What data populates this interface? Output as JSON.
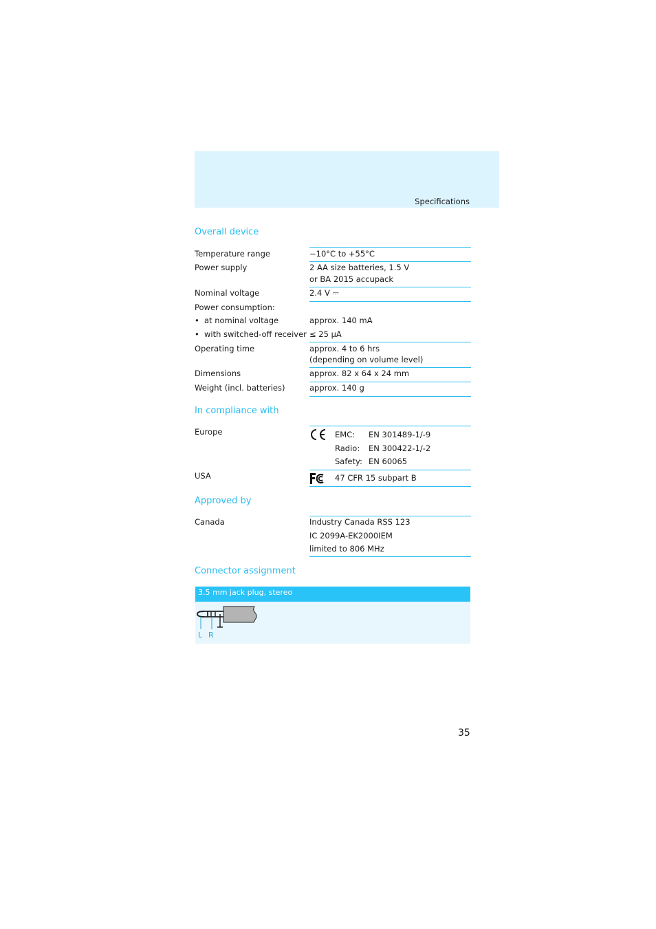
{
  "header": {
    "title": "Specifications"
  },
  "overall_device": {
    "heading": "Overall device",
    "rows": [
      {
        "label": "Temperature range",
        "value": "−10°C to +55°C"
      },
      {
        "label": "Power supply",
        "value": "2 AA size batteries, 1.5 V",
        "value2": "or BA 2015 accupack"
      },
      {
        "label": "Nominal voltage",
        "value": "2.4 V ⎓"
      },
      {
        "label": "Power consumption:"
      },
      {
        "label": "at nominal voltage",
        "value": "approx. 140 mA"
      },
      {
        "label": "with switched-off receiver",
        "value": "≤ 25 µA"
      },
      {
        "label": "Operating time",
        "value": "approx. 4 to 6 hrs",
        "value2": "(depending on volume level)"
      },
      {
        "label": "Dimensions",
        "value": "approx. 82 x 64 x 24 mm"
      },
      {
        "label": "Weight (incl. batteries)",
        "value": "approx. 140 g"
      }
    ]
  },
  "compliance": {
    "heading": "In compliance with",
    "europe": {
      "label": "Europe",
      "icon": "ce-mark-icon",
      "items": [
        {
          "key": "EMC:",
          "value": "EN 301489-1/-9"
        },
        {
          "key": "Radio:",
          "value": "EN 300422-1/-2"
        },
        {
          "key": "Safety:",
          "value": "EN 60065"
        }
      ]
    },
    "usa": {
      "label": "USA",
      "icon": "fcc-logo-icon",
      "value": "47 CFR 15 subpart B"
    }
  },
  "approved": {
    "heading": "Approved by",
    "canada": {
      "label": "Canada",
      "lines": [
        "Industry Canada RSS 123",
        "IC 2099A-EK2000IEM",
        "limited to 806 MHz"
      ]
    }
  },
  "connector": {
    "heading": "Connector assignment",
    "bar_label": "3.5 mm jack plug, stereo",
    "pins": [
      "L",
      "R"
    ]
  },
  "page_number": "35"
}
